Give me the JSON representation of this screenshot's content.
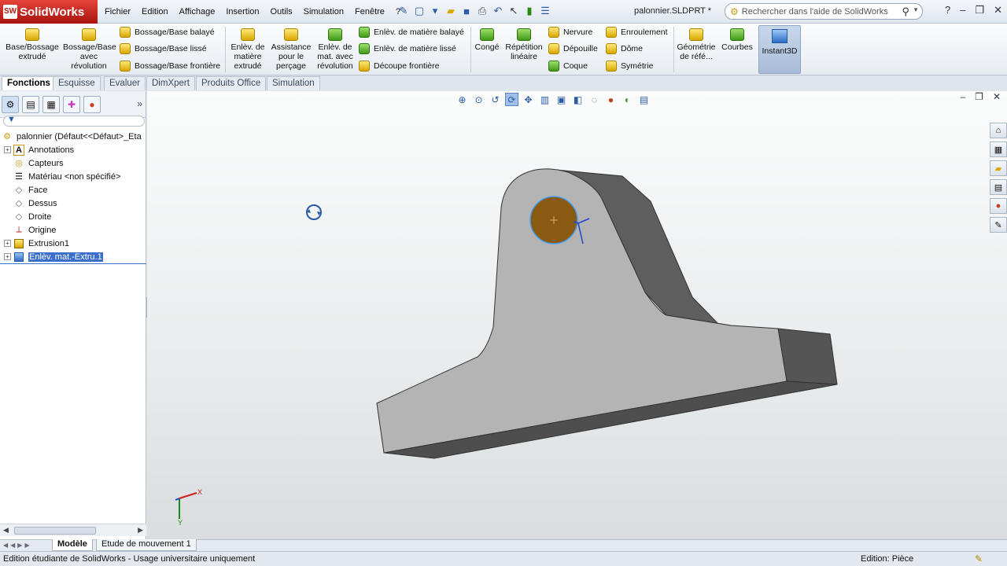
{
  "app": {
    "name": "SolidWorks",
    "doc_title": "palonnier.SLDPRT *"
  },
  "menu": [
    "Fichier",
    "Edition",
    "Affichage",
    "Insertion",
    "Outils",
    "Simulation",
    "Fenêtre"
  ],
  "search": {
    "placeholder": "Rechercher dans l'aide de SolidWorks"
  },
  "ribbon": {
    "base_bossage": "Base/Bossage extrudé",
    "bossage_revolution": "Bossage/Base avec révolution",
    "bossage_balaye": "Bossage/Base balayé",
    "bossage_lisse": "Bossage/Base lissé",
    "bossage_frontiere": "Bossage/Base frontière",
    "enlev_extrude": "Enlèv. de matière extrudé",
    "assistance_percage": "Assistance pour le perçage",
    "enlev_revolution": "Enlèv. de mat. avec révolution",
    "enlev_balaye": "Enlèv. de matière balayé",
    "enlev_lisse": "Enlèv. de matière lissé",
    "decoupe_frontiere": "Découpe frontière",
    "conge": "Congé",
    "repetition": "Répétition linéaire",
    "nervure": "Nervure",
    "depouille": "Dépouille",
    "coque": "Coque",
    "enroulement": "Enroulement",
    "dome": "Dôme",
    "symetrie": "Symétrie",
    "geometrie": "Géométrie de réfé...",
    "courbes": "Courbes",
    "instant3d": "Instant3D"
  },
  "tabs": [
    "Fonctions",
    "Esquisse",
    "Evaluer",
    "DimXpert",
    "Produits Office",
    "Simulation"
  ],
  "tree": {
    "root": "palonnier  (Défaut<<Défaut>_Eta",
    "items": [
      {
        "label": "Annotations",
        "icon": "annotations-icon"
      },
      {
        "label": "Capteurs",
        "icon": "sensor-icon"
      },
      {
        "label": "Matériau <non spécifié>",
        "icon": "material-icon"
      },
      {
        "label": "Face",
        "icon": "plane-icon"
      },
      {
        "label": "Dessus",
        "icon": "plane-icon"
      },
      {
        "label": "Droite",
        "icon": "plane-icon"
      },
      {
        "label": "Origine",
        "icon": "origin-icon"
      },
      {
        "label": "Extrusion1",
        "icon": "extrude-icon"
      },
      {
        "label": "Enlèv. mat.-Extru.1",
        "icon": "cut-extrude-icon",
        "selected": true
      }
    ]
  },
  "axes": {
    "x": "X",
    "y": "Y"
  },
  "bottom_tabs": [
    "Modèle",
    "Etude de mouvement 1"
  ],
  "status": {
    "left": "Edition étudiante de SolidWorks - Usage universitaire uniquement",
    "right": "Edition: Pièce"
  },
  "colors": {
    "hole": "#8a5a12",
    "part_face": "#b4b4b4",
    "part_dark": "#5e5e5e",
    "selection": "#3a6fcb"
  }
}
